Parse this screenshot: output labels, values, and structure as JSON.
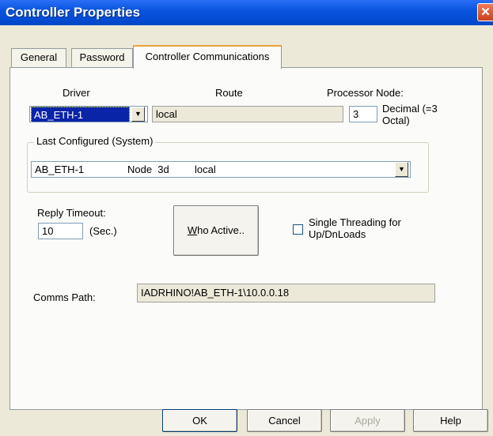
{
  "window": {
    "title": "Controller Properties",
    "close_glyph": "✕"
  },
  "tabs": [
    {
      "label": "General",
      "active": false
    },
    {
      "label": "Password",
      "active": false
    },
    {
      "label": "Controller Communications",
      "active": true
    }
  ],
  "driver": {
    "label": "Driver",
    "value": "AB_ETH-1"
  },
  "route": {
    "label": "Route",
    "value": "local"
  },
  "processor_node": {
    "label": "Processor Node:",
    "value": "3",
    "note_line1": "Decimal (=3",
    "note_line2": "Octal)"
  },
  "last_configured": {
    "legend": "Last Configured (System)",
    "driver": "AB_ETH-1",
    "node": "Node  3d",
    "route": "local"
  },
  "reply_timeout": {
    "label": "Reply Timeout:",
    "value": "10",
    "unit": "(Sec.)"
  },
  "who_active_button": {
    "prefix": "W",
    "rest": "ho Active.."
  },
  "single_threading": {
    "line1": "Single Threading for",
    "line2": "Up/DnLoads",
    "checked": false
  },
  "comms_path": {
    "label": "Comms Path:",
    "value": "IADRHINO!AB_ETH-1\\10.0.0.18"
  },
  "buttons": {
    "ok": "OK",
    "cancel": "Cancel",
    "apply": "Apply",
    "help": "Help"
  },
  "colors": {
    "title_bar": "#0a55e0",
    "selection": "#0a24a8",
    "active_tab_accent": "#e8a33a",
    "window_bg": "#ece9d8"
  }
}
